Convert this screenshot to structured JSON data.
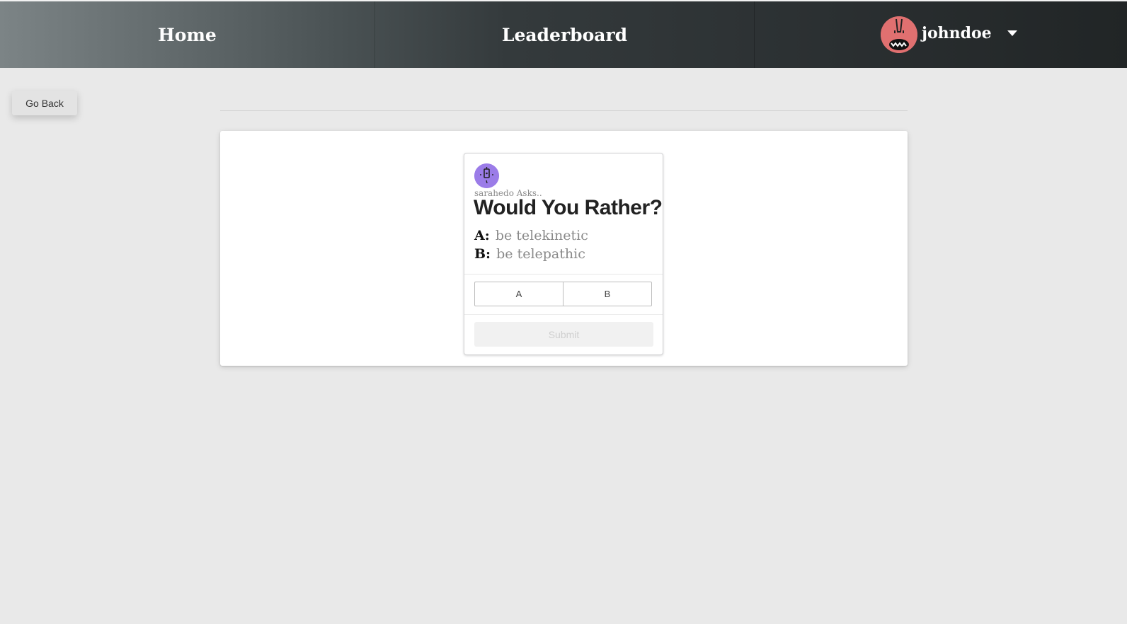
{
  "nav": {
    "home": "Home",
    "leaderboard": "Leaderboard",
    "username": "johndoe",
    "user_menu_icon": "chevron-down-icon"
  },
  "go_back": "Go Back",
  "question": {
    "asker": "sarahedo Asks..",
    "title": "Would You Rather?",
    "option_a_label": "A:",
    "option_a_text": "be telekinetic",
    "option_b_label": "B:",
    "option_b_text": "be telepathic",
    "choice_a": "A",
    "choice_b": "B",
    "submit": "Submit"
  },
  "colors": {
    "background": "#e9e9e9",
    "user_avatar": "#e07070",
    "asker_avatar": "#9b7ce8"
  }
}
